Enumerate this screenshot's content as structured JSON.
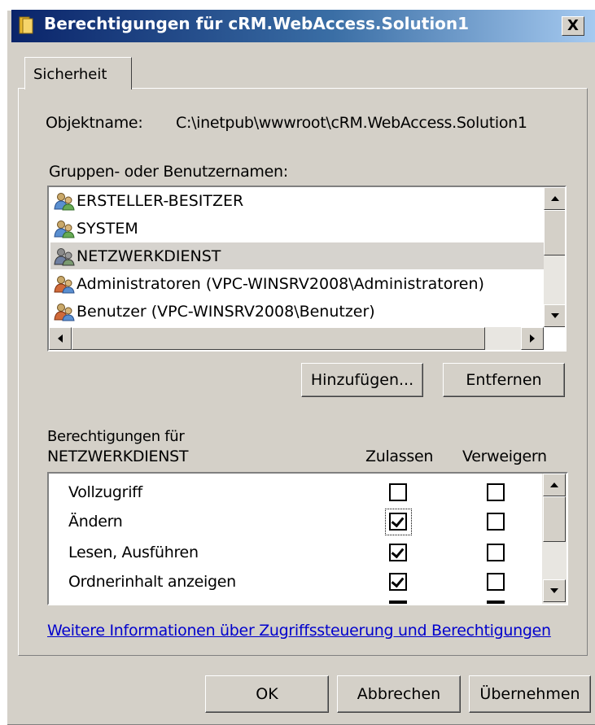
{
  "window": {
    "title": "Berechtigungen für cRM.WebAccess.Solution1",
    "close_label": "X"
  },
  "tabs": [
    {
      "label": "Sicherheit"
    }
  ],
  "object": {
    "label": "Objektname:",
    "value": "C:\\inetpub\\wwwroot\\cRM.WebAccess.Solution1"
  },
  "groups": {
    "label": "Gruppen- oder Benutzernamen:",
    "items": [
      {
        "label": "ERSTELLER-BESITZER",
        "icon": "users-icon"
      },
      {
        "label": "SYSTEM",
        "icon": "users-icon"
      },
      {
        "label": "NETZWERKDIENST",
        "icon": "users-icon",
        "selected": true
      },
      {
        "label": "Administratoren (VPC-WINSRV2008\\Administratoren)",
        "icon": "users-icon"
      },
      {
        "label": "Benutzer (VPC-WINSRV2008\\Benutzer)",
        "icon": "users-icon"
      }
    ],
    "add_button": "Hinzufügen...",
    "remove_button": "Entfernen"
  },
  "permissions": {
    "label_line1": "Berechtigungen für",
    "label_line2": "NETZWERKDIENST",
    "allow_header": "Zulassen",
    "deny_header": "Verweigern",
    "rows": [
      {
        "name": "Vollzugriff",
        "allow": false,
        "deny": false
      },
      {
        "name": "Ändern",
        "allow": true,
        "deny": false
      },
      {
        "name": "Lesen, Ausführen",
        "allow": true,
        "deny": false
      },
      {
        "name": "Ordnerinhalt anzeigen",
        "allow": true,
        "deny": false
      }
    ]
  },
  "info_link": "Weitere Informationen über Zugriffssteuerung und Berechtigungen",
  "footer": {
    "ok": "OK",
    "cancel": "Abbrechen",
    "apply": "Übernehmen"
  },
  "colors": {
    "dialog_bg": "#d4d0c8",
    "selection": "#d6d3ce",
    "link": "#0000cc"
  }
}
